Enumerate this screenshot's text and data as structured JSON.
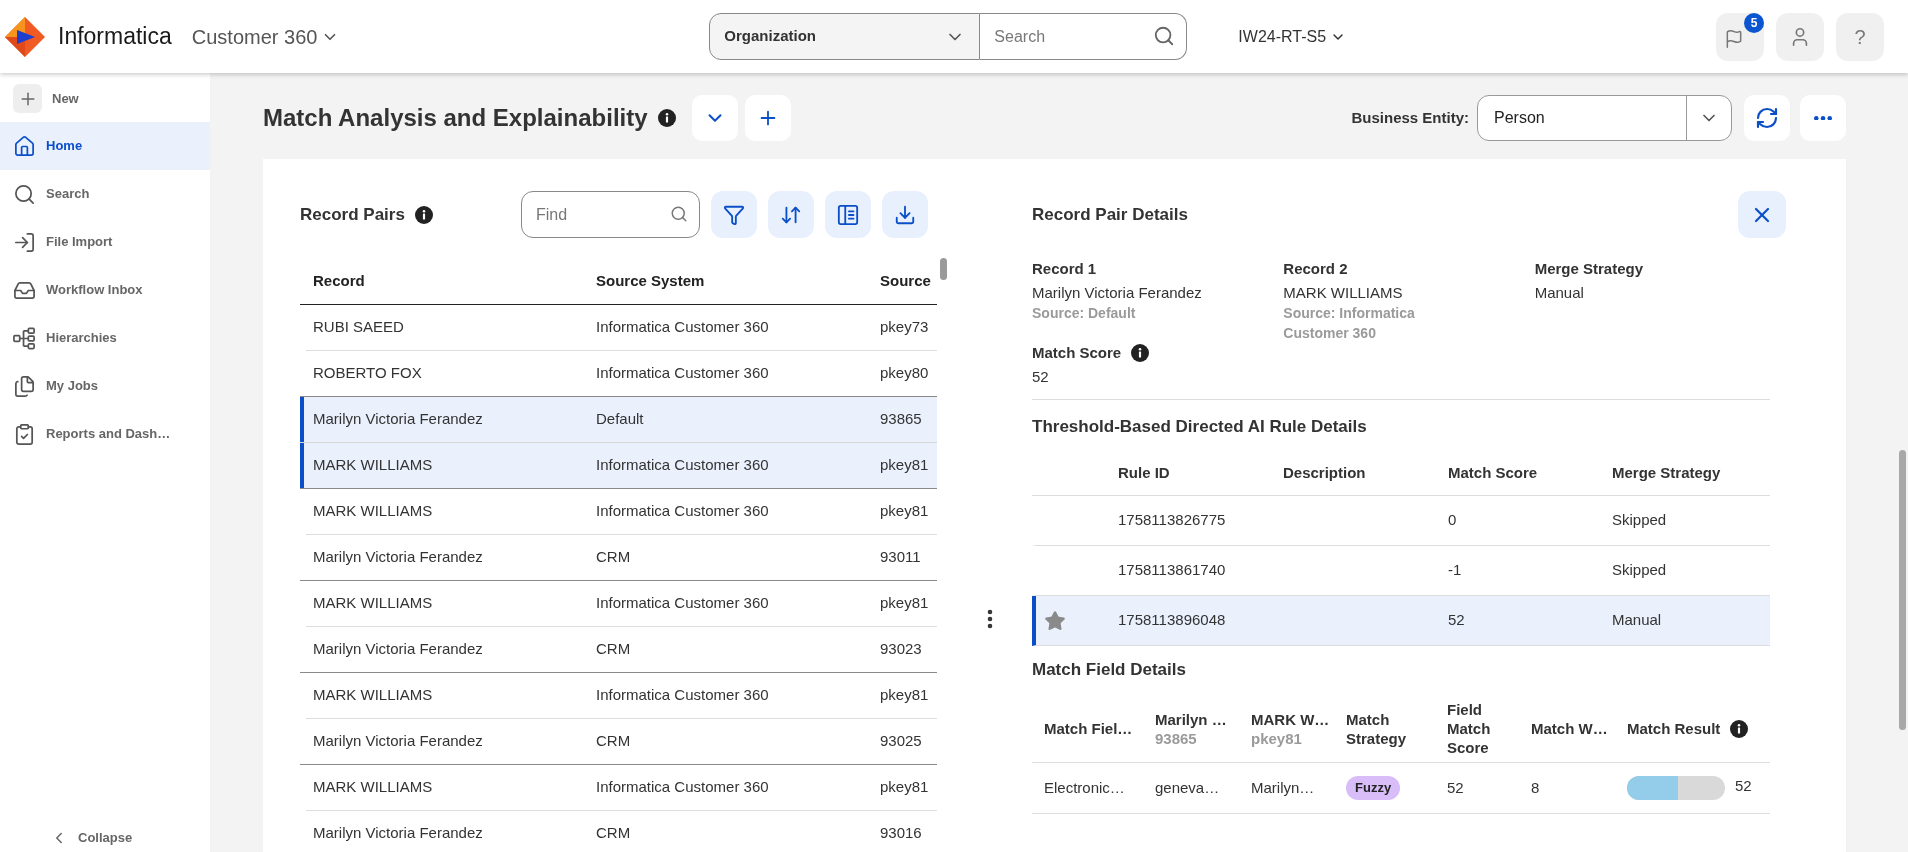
{
  "app_bar": {
    "brand": "Informatica",
    "product": "Customer 360",
    "scope": "Organization",
    "search": {
      "placeholder": "Search"
    },
    "org": "IW24-RT-S5",
    "notifications": "5",
    "help": "?"
  },
  "sidebar": {
    "new": "New",
    "items": [
      {
        "label": "Home",
        "selected": true
      },
      {
        "label": "Search",
        "selected": false
      },
      {
        "label": "File Import",
        "selected": false
      },
      {
        "label": "Workflow Inbox",
        "selected": false
      },
      {
        "label": "Hierarchies",
        "selected": false
      },
      {
        "label": "My Jobs",
        "selected": false
      },
      {
        "label": "Reports and Dash…",
        "selected": false
      }
    ],
    "collapse": "Collapse"
  },
  "page": {
    "title": "Match Analysis and Explainability",
    "business_entity": {
      "label": "Business Entity:",
      "value": "Person"
    }
  },
  "record_pairs": {
    "title": "Record Pairs",
    "find": {
      "placeholder": "Find"
    },
    "columns": [
      "Record",
      "Source System",
      "Source"
    ],
    "pairs": [
      {
        "selected": false,
        "rows": [
          {
            "record": "RUBI SAEED",
            "source_system": "Informatica Customer 360",
            "source": "pkey73"
          },
          {
            "record": "ROBERTO FOX",
            "source_system": "Informatica Customer 360",
            "source": "pkey80"
          }
        ]
      },
      {
        "selected": true,
        "rows": [
          {
            "record": "Marilyn Victoria Ferandez",
            "source_system": "Default",
            "source": "93865"
          },
          {
            "record": "MARK WILLIAMS",
            "source_system": "Informatica Customer 360",
            "source": "pkey81"
          }
        ]
      },
      {
        "selected": false,
        "rows": [
          {
            "record": "MARK WILLIAMS",
            "source_system": "Informatica Customer 360",
            "source": "pkey81"
          },
          {
            "record": "Marilyn Victoria Ferandez",
            "source_system": "CRM",
            "source": "93011"
          }
        ]
      },
      {
        "selected": false,
        "rows": [
          {
            "record": "MARK WILLIAMS",
            "source_system": "Informatica Customer 360",
            "source": "pkey81"
          },
          {
            "record": "Marilyn Victoria Ferandez",
            "source_system": "CRM",
            "source": "93023"
          }
        ]
      },
      {
        "selected": false,
        "rows": [
          {
            "record": "MARK WILLIAMS",
            "source_system": "Informatica Customer 360",
            "source": "pkey81"
          },
          {
            "record": "Marilyn Victoria Ferandez",
            "source_system": "CRM",
            "source": "93025"
          }
        ]
      },
      {
        "selected": false,
        "rows": [
          {
            "record": "MARK WILLIAMS",
            "source_system": "Informatica Customer 360",
            "source": "pkey81"
          },
          {
            "record": "Marilyn Victoria Ferandez",
            "source_system": "CRM",
            "source": "93016"
          }
        ]
      }
    ]
  },
  "record_pair_details": {
    "title": "Record Pair Details",
    "records": [
      {
        "label": "Record 1",
        "value": "Marilyn Victoria Ferandez",
        "source": "Source: Default"
      },
      {
        "label": "Record 2",
        "value": "MARK WILLIAMS",
        "source": "Source: Informatica Customer 360"
      },
      {
        "label": "Merge Strategy",
        "value": "Manual"
      }
    ],
    "match_score": {
      "label": "Match Score",
      "value": "52"
    }
  },
  "rule_details": {
    "title": "Threshold-Based Directed AI Rule Details",
    "columns": [
      "Rule ID",
      "Description",
      "Match Score",
      "Merge Strategy"
    ],
    "rows": [
      {
        "rule_id": "1758113826775",
        "match_score": "0",
        "merge_strategy": "Skipped",
        "selected": false
      },
      {
        "rule_id": "1758113861740",
        "match_score": "-1",
        "merge_strategy": "Skipped",
        "selected": false
      },
      {
        "rule_id": "1758113896048",
        "match_score": "52",
        "merge_strategy": "Manual",
        "selected": true
      }
    ]
  },
  "match_field_details": {
    "title": "Match Field Details",
    "columns": [
      {
        "label": "Match Fiel…"
      },
      {
        "label": "Marilyn …",
        "sublabel": "93865"
      },
      {
        "label": "MARK W…",
        "sublabel": "pkey81"
      },
      {
        "label": "Match Strategy"
      },
      {
        "label": "Field Match Score"
      },
      {
        "label": "Match W…"
      },
      {
        "label": "Match Result",
        "info": true
      }
    ],
    "rows": [
      {
        "column_1": "Electronic…",
        "column_2": "geneva…",
        "column_3": "Marilyn…",
        "match_strategy": "Fuzzy",
        "field_match_score": "52",
        "column_6": "8",
        "match_result": {
          "level": 0.52,
          "reading": "52"
        }
      }
    ]
  }
}
